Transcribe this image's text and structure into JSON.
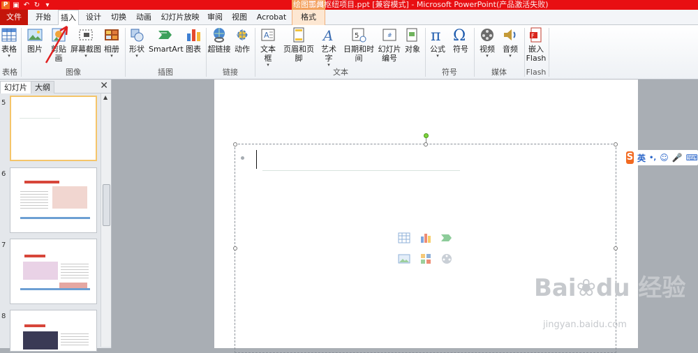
{
  "window": {
    "title": "鄂州枢纽项目.ppt [兼容模式] - Microsoft PowerPoint(产品激活失败)"
  },
  "tabs": {
    "file": "文件",
    "home": "开始",
    "insert": "插入",
    "design": "设计",
    "transitions": "切换",
    "animations": "动画",
    "slideshow": "幻灯片放映",
    "review": "审阅",
    "view": "视图",
    "acrobat": "Acrobat",
    "context_group": "绘图工具",
    "format": "格式"
  },
  "ribbon": {
    "table": "表格",
    "picture": "图片",
    "clipart": "剪贴画",
    "screenshot": "屏幕截图",
    "album": "相册",
    "shapes": "形状",
    "smartart": "SmartArt",
    "chart": "图表",
    "hyperlink": "超链接",
    "action": "动作",
    "textbox": "文本框",
    "headerfooter": "页眉和页脚",
    "wordart": "艺术字",
    "datetime": "日期和时间",
    "slidenumber_1": "幻灯片",
    "slidenumber_2": "编号",
    "object": "对象",
    "equation": "公式",
    "symbol": "符号",
    "video": "视频",
    "audio": "音频",
    "flash_1": "嵌入",
    "flash_2": "Flash",
    "groups": {
      "tables": "表格",
      "images": "图像",
      "illustrations": "插图",
      "links": "链接",
      "text": "文本",
      "symbols": "符号",
      "media": "媒体",
      "flash": "Flash"
    }
  },
  "panel": {
    "tab_slides": "幻灯片",
    "tab_outline": "大纲",
    "slide_numbers": [
      "5",
      "6",
      "7",
      "8"
    ]
  },
  "ime": {
    "logo": "S",
    "mode": "英",
    "punct": "•,"
  },
  "watermark": {
    "brand": "Bai❀du 经验",
    "url": "jingyan.baidu.com"
  }
}
